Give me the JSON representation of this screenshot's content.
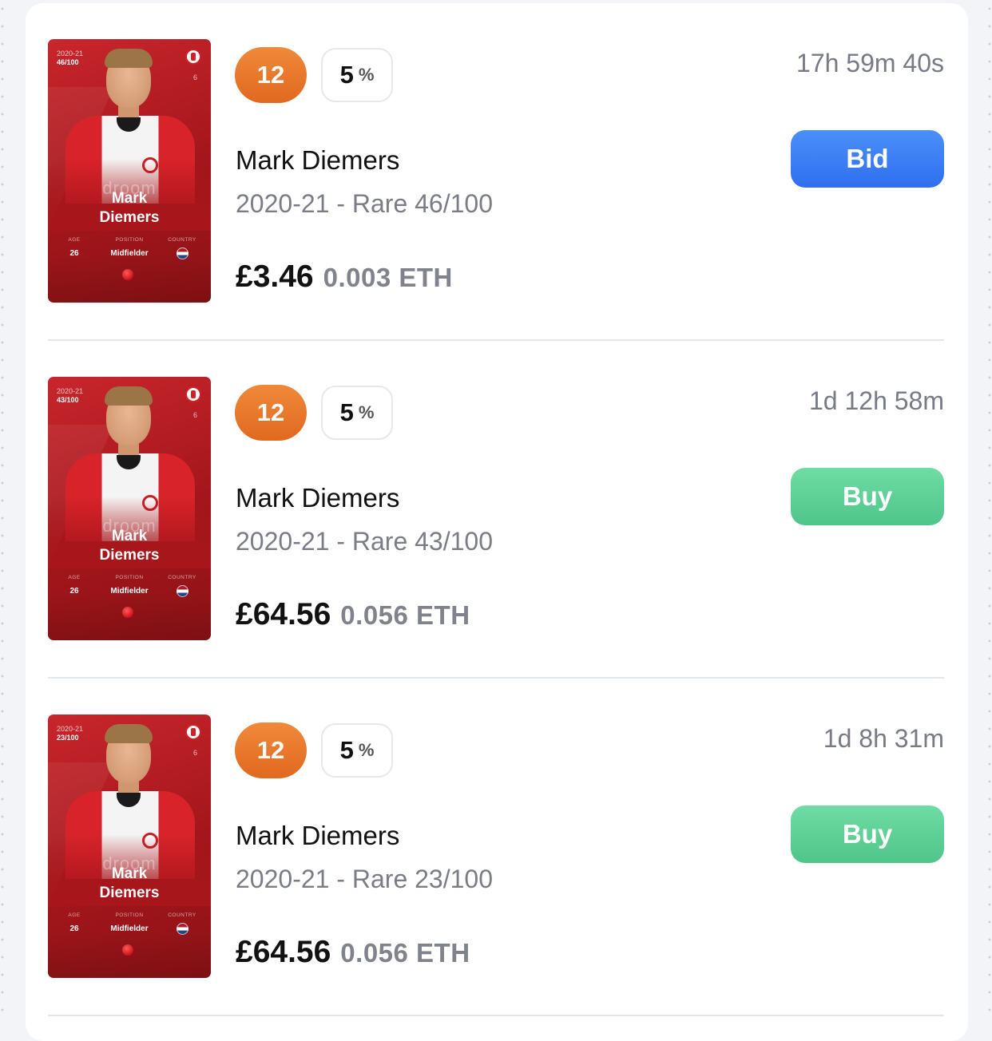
{
  "listings": [
    {
      "card": {
        "season": "2020-21",
        "serial": "46/100",
        "number": "6",
        "name": "Mark Diemers",
        "sponsor": "droom",
        "age_label": "AGE",
        "age": "26",
        "position_label": "POSITION",
        "position": "Midfielder",
        "country_label": "COUNTRY"
      },
      "score": "12",
      "percent": "5",
      "timer": "17h 59m 40s",
      "player_name": "Mark Diemers",
      "edition": "2020-21 - Rare 46/100",
      "price_gbp": "£3.46",
      "price_eth": "0.003 ETH",
      "action": "Bid"
    },
    {
      "card": {
        "season": "2020-21",
        "serial": "43/100",
        "number": "6",
        "name": "Mark Diemers",
        "sponsor": "droom",
        "age_label": "AGE",
        "age": "26",
        "position_label": "POSITION",
        "position": "Midfielder",
        "country_label": "COUNTRY"
      },
      "score": "12",
      "percent": "5",
      "timer": "1d 12h 58m",
      "player_name": "Mark Diemers",
      "edition": "2020-21 - Rare 43/100",
      "price_gbp": "£64.56",
      "price_eth": "0.056 ETH",
      "action": "Buy"
    },
    {
      "card": {
        "season": "2020-21",
        "serial": "23/100",
        "number": "6",
        "name": "Mark Diemers",
        "sponsor": "droom",
        "age_label": "AGE",
        "age": "26",
        "position_label": "POSITION",
        "position": "Midfielder",
        "country_label": "COUNTRY"
      },
      "score": "12",
      "percent": "5",
      "timer": "1d 8h 31m",
      "player_name": "Mark Diemers",
      "edition": "2020-21 - Rare 23/100",
      "price_gbp": "£64.56",
      "price_eth": "0.056 ETH",
      "action": "Buy"
    }
  ],
  "colors": {
    "score_badge": "#e87a2b",
    "bid_button": "#3b7ef5",
    "buy_button": "#5ccf95",
    "card_red": "#b81c22"
  },
  "icons": {
    "percent_badge": "percent-icon",
    "country": "netherlands-flag-icon",
    "club": "feyenoord-crest-icon"
  }
}
